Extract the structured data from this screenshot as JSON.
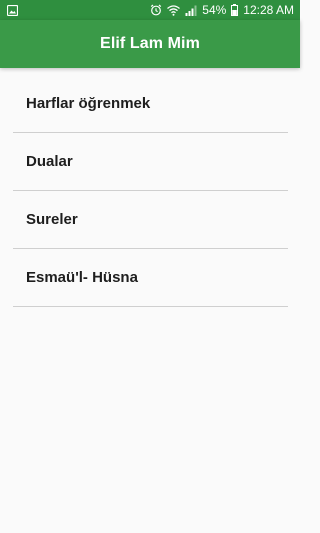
{
  "status_bar": {
    "battery_percent": "54%",
    "time": "12:28 AM",
    "icons": [
      "image-icon",
      "alarm-icon",
      "wifi-icon",
      "signal-icon",
      "battery-icon"
    ]
  },
  "app_bar": {
    "title": "Elif Lam Mim"
  },
  "menu": {
    "items": [
      {
        "label": "Harflar öğrenmek"
      },
      {
        "label": "Dualar"
      },
      {
        "label": "Sureler"
      },
      {
        "label": "Esmaü'l- Hüsna"
      }
    ]
  },
  "colors": {
    "status_bar": "#2f8f3f",
    "app_bar": "#3a9a48",
    "background": "#fafafa",
    "divider": "#cfcfcf",
    "text": "#1e1e1e"
  }
}
